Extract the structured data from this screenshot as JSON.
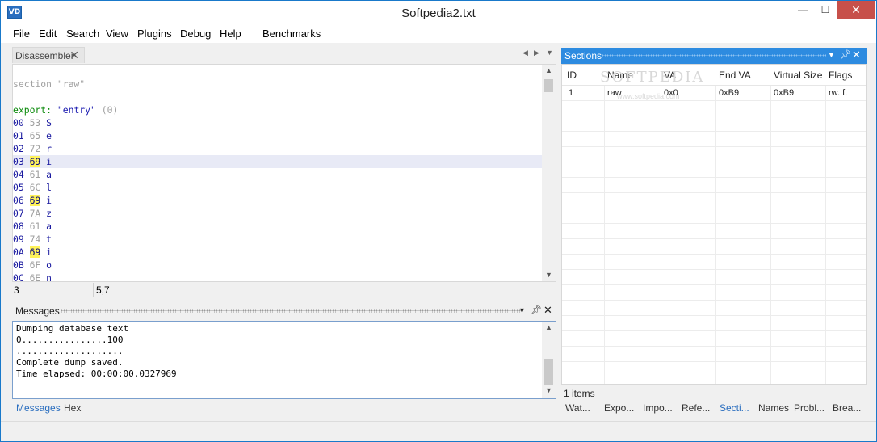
{
  "window": {
    "title": "Softpedia2.txt",
    "icon_text": "VD",
    "buttons": {
      "minimize": "—",
      "maximize": "☐",
      "close": "✕"
    }
  },
  "menu": [
    "File",
    "Edit",
    "Search",
    "View",
    "Plugins",
    "Debug",
    "Help",
    "Benchmarks"
  ],
  "disassembler": {
    "tab_label": "Disassembler",
    "section_line": "section \"raw\"",
    "export_keyword": "export:",
    "export_name": "\"entry\"",
    "export_offset": "(0)",
    "rows": [
      {
        "addr": "00",
        "hex": "53",
        "char": "S",
        "marked": false
      },
      {
        "addr": "01",
        "hex": "65",
        "char": "e",
        "marked": false
      },
      {
        "addr": "02",
        "hex": "72",
        "char": "r",
        "marked": false
      },
      {
        "addr": "03",
        "hex": "69",
        "char": "i",
        "marked": true
      },
      {
        "addr": "04",
        "hex": "61",
        "char": "a",
        "marked": false
      },
      {
        "addr": "05",
        "hex": "6C",
        "char": "l",
        "marked": false
      },
      {
        "addr": "06",
        "hex": "69",
        "char": "i",
        "marked": true
      },
      {
        "addr": "07",
        "hex": "7A",
        "char": "z",
        "marked": false
      },
      {
        "addr": "08",
        "hex": "61",
        "char": "a",
        "marked": false
      },
      {
        "addr": "09",
        "hex": "74",
        "char": "t",
        "marked": false
      },
      {
        "addr": "0A",
        "hex": "69",
        "char": "i",
        "marked": true
      },
      {
        "addr": "0B",
        "hex": "6F",
        "char": "o",
        "marked": false
      },
      {
        "addr": "0C",
        "hex": "6E",
        "char": "n",
        "marked": false
      }
    ],
    "status_line": "3",
    "status_pos": "5,7"
  },
  "messages": {
    "title": "Messages",
    "lines": [
      "Dumping database text",
      "0................100",
      "....................",
      "Complete dump saved.",
      "Time elapsed: 00:00:00.0327969"
    ],
    "tabs": [
      "Messages",
      "Hex"
    ]
  },
  "sections": {
    "title": "Sections",
    "columns": [
      "ID",
      "Name",
      "VA",
      "End VA",
      "Virtual Size",
      "Flags"
    ],
    "rows": [
      {
        "id": "1",
        "name": "raw",
        "va": "0x0",
        "end_va": "0xB9",
        "virtual_size": "0xB9",
        "flags": "rw..f."
      }
    ],
    "items_count": "1 items",
    "watermark": "SOFTPEDIA",
    "watermark_url": "www.softpedia.com"
  },
  "right_tabs": [
    "Wat...",
    "Expo...",
    "Impo...",
    "Refe...",
    "Secti...",
    "Names",
    "Probl...",
    "Brea..."
  ]
}
